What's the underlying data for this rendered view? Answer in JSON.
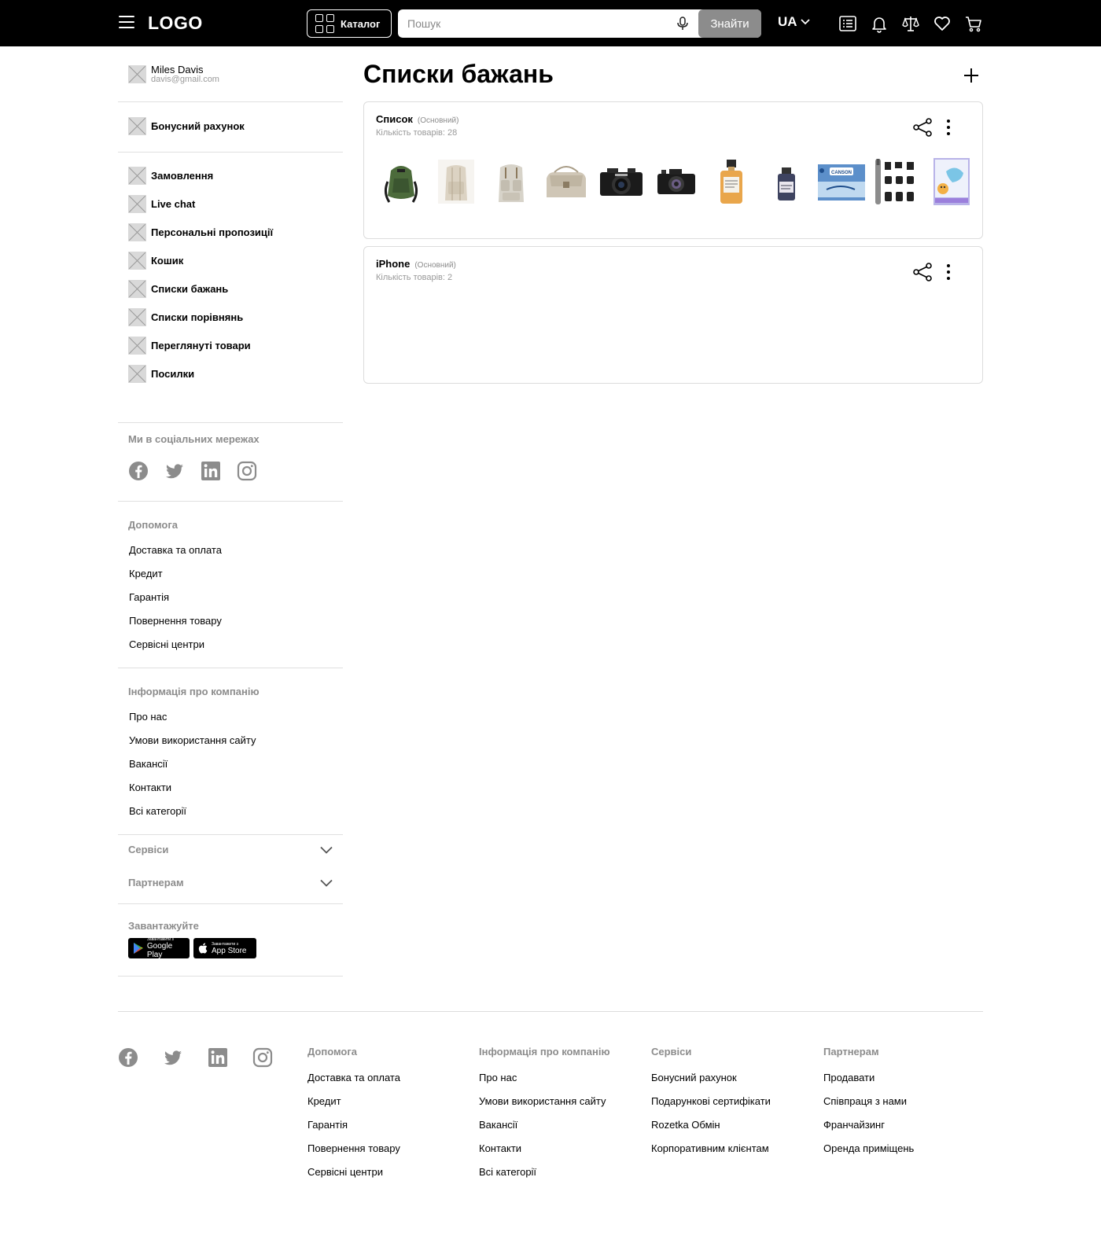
{
  "header": {
    "logo": "LOGO",
    "catalog_label": "Каталог",
    "search_placeholder": "Пошук",
    "search_button": "Знайти",
    "language": "UA"
  },
  "user": {
    "name": "Miles Davis",
    "email": "davis@gmail.com"
  },
  "sidebar": {
    "bonus": "Бонусний рахунок",
    "items": [
      "Замовлення",
      "Live chat",
      "Персональні пропозиції",
      "Кошик",
      "Списки бажань",
      "Списки порівнянь",
      "Переглянуті товари",
      "Посилки"
    ],
    "social_title": "Ми в соціальних мережах",
    "help_title": "Допомога",
    "help_links": [
      "Доставка та оплата",
      "Кредит",
      "Гарантія",
      "Повернення товару",
      "Сервісні центри"
    ],
    "company_title": "Інформація про компанію",
    "company_links": [
      "Про нас",
      "Умови використання сайту",
      "Вакансії",
      "Контакти",
      "Всі категорії"
    ],
    "services_title": "Сервіси",
    "partners_title": "Партнерам",
    "download_title": "Завантажуйте",
    "google_play_small": "Завантажити з",
    "google_play": "Google Play",
    "app_store_small": "Завантажити з",
    "app_store": "App Store"
  },
  "main": {
    "title": "Списки бажань",
    "lists": [
      {
        "name": "Список",
        "tag": "(Основний)",
        "count": "Кількість товарів: 28"
      },
      {
        "name": "iPhone",
        "tag": "(Основний)",
        "count": "Кількість товарів: 2"
      }
    ],
    "thumbnails": [
      "green-backpack",
      "beige-backpack",
      "canvas-backpack",
      "canvas-bag",
      "fujifilm-camera",
      "mirrorless-camera",
      "perfume-bottle",
      "ink-bottle",
      "canson-paper",
      "trimmer-set",
      "dog-toy-box"
    ]
  },
  "footer": {
    "columns": [
      {
        "title": "Допомога",
        "links": [
          "Доставка та оплата",
          "Кредит",
          "Гарантія",
          "Повернення товару",
          "Сервісні центри"
        ]
      },
      {
        "title": "Інформація про компанію",
        "links": [
          "Про нас",
          "Умови використання сайту",
          "Вакансії",
          "Контакти",
          "Всі категорії"
        ]
      },
      {
        "title": "Сервіси",
        "links": [
          "Бонусний рахунок",
          "Подарункові сертифікати",
          "Rozetka Обмін",
          "Корпоративним клієнтам"
        ]
      },
      {
        "title": "Партнерам",
        "links": [
          "Продавати",
          "Співпраця з нами",
          "Франчайзинг",
          "Оренда приміщень"
        ]
      }
    ]
  },
  "colors": {
    "header_bg": "#000000",
    "search_button": "#8c8c8c",
    "muted_text": "#8c8c8c"
  }
}
